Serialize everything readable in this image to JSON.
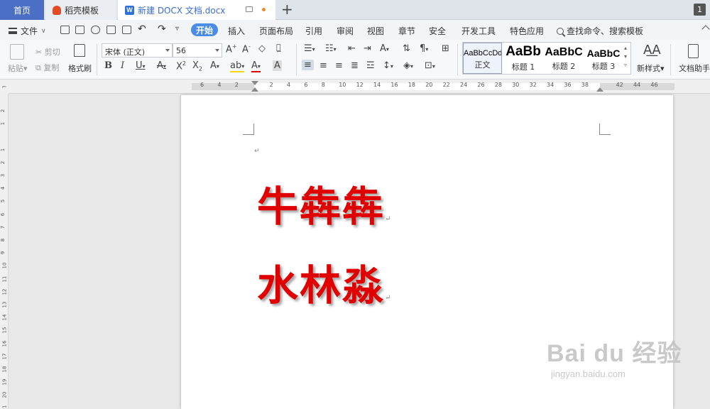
{
  "tabs": {
    "home": "首页",
    "daoke": "稻壳模板",
    "doc": "新建 DOCX 文档.docx",
    "window_count": "1"
  },
  "menu": {
    "file": "文件",
    "items": [
      "开始",
      "插入",
      "页面布局",
      "引用",
      "审阅",
      "视图",
      "章节",
      "安全",
      "开发工具",
      "特色应用"
    ],
    "search": "查找命令、搜索模板"
  },
  "ribbon": {
    "paste": "粘贴",
    "cut": "剪切",
    "copy": "复制",
    "format_painter": "格式刷",
    "font_name": "宋体 (正文)",
    "font_size": "56",
    "styles": [
      {
        "sample": "AaBbCcDd",
        "label": "正文"
      },
      {
        "sample": "AaBb",
        "label": "标题 1"
      },
      {
        "sample": "AaBbC",
        "label": "标题 2"
      },
      {
        "sample": "AaBbC",
        "label": "标题 3"
      }
    ],
    "new_style": "新样式",
    "doc_assistant": "文档助手"
  },
  "ruler": {
    "numbers": [
      "6",
      "4",
      "2",
      "",
      "2",
      "4",
      "6",
      "8",
      "10",
      "12",
      "14",
      "16",
      "18",
      "20",
      "22",
      "24",
      "26",
      "28",
      "30",
      "32",
      "34",
      "36",
      "38",
      "",
      "42",
      "44",
      "46"
    ],
    "vertical": [
      "2",
      "1",
      "",
      "1",
      "2",
      "3",
      "4",
      "5",
      "6",
      "7",
      "8",
      "9",
      "10",
      "11",
      "12",
      "13",
      "14",
      "15",
      "16",
      "17",
      "18",
      "19",
      "20",
      "21"
    ]
  },
  "document": {
    "line1": "牛犇犇",
    "line2": "水林淼",
    "text_color": "#e00000"
  },
  "watermark": {
    "main": "Bai du 经验",
    "sub": "jingyan.baidu.com"
  }
}
